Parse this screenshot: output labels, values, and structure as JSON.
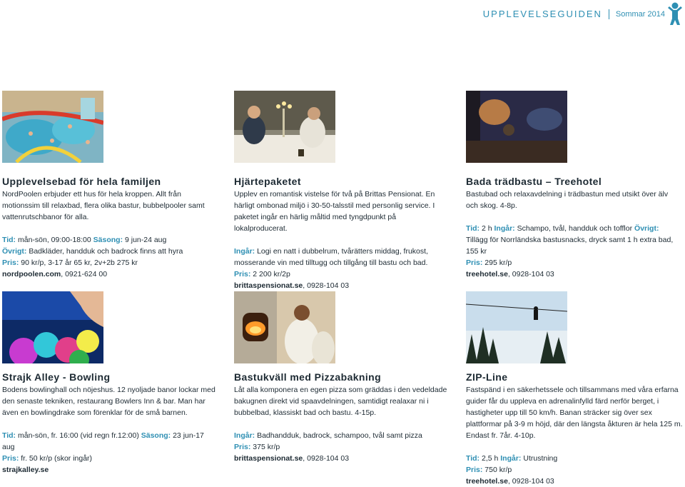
{
  "header": {
    "title": "UPPLEVELSEGUIDEN",
    "season": "Sommar 2014",
    "logo_icon": "person-jumping-icon"
  },
  "colors": {
    "accent": "#2e8fb3",
    "text": "#1d2a33"
  },
  "cards": [
    {
      "title": "Upplevelsebad för hela familjen",
      "intro": "NordPoolen erbjuder ett hus för hela kroppen. Allt från motionssim till relaxbad, flera olika bastur, bubbelpooler samt vattenrutschbanor för alla.",
      "tid_label": "Tid:",
      "tid": "mån-sön, 09:00-18:00",
      "sasong_label": "Säsong:",
      "sasong": "9 jun-24 aug",
      "ovrigt_label": "Övrigt:",
      "ovrigt": "Badkläder, handduk och badrock finns att hyra",
      "pris_label": "Pris:",
      "pris": "90 kr/p, 3-17 år 65 kr, 2v+2b 275 kr",
      "web": "nordpoolen.com",
      "phone": ", 0921-624 00"
    },
    {
      "title": "Hjärtepaketet",
      "intro": "Upplev en romantisk vistelse för två på Brittas Pensionat. En härligt ombonad miljö i 30-50-talsstil med personlig service. I paketet ingår en härlig måltid med tyngdpunkt på lokalproducerat.",
      "ingar_label": "Ingår:",
      "ingar": "Logi en natt i dubbelrum, tvårätters middag, frukost, mosserande vin med tilltugg och tillgång till bastu och bad.",
      "pris_label": "Pris:",
      "pris": "2 200 kr/2p",
      "web": "brittaspensionat.se",
      "phone": ", 0928-104 03"
    },
    {
      "title": "Bada trädbastu – Treehotel",
      "intro": "Bastubad och relaxavdelning i trädbastun med utsikt över älv och skog. 4-8p.",
      "tid_label": "Tid:",
      "tid": "2 h",
      "ingar_label": "Ingår:",
      "ingar": "Schampo, tvål, handduk och tofflor",
      "ovrigt_label": "Övrigt:",
      "ovrigt": "Tillägg för Norrländska bastusnacks, dryck samt 1 h extra bad, 155 kr",
      "pris_label": "Pris:",
      "pris": "295 kr/p",
      "web": "treehotel.se",
      "phone": ", 0928-104 03"
    },
    {
      "title": "Strajk Alley - Bowling",
      "intro": "Bodens bowlinghall och nöjeshus. 12 nyoljade banor lockar med den senaste tekniken, restaurang Bowlers Inn & bar. Man har även en bowlingdrake som förenklar för de små barnen.",
      "tid_label": "Tid:",
      "tid": "mån-sön, fr. 16:00 (vid regn fr.12:00)",
      "sasong_label": "Säsong:",
      "sasong": "23 jun-17 aug",
      "pris_label": "Pris:",
      "pris": "fr. 50 kr/p (skor ingår)",
      "web": "strajkalley.se"
    },
    {
      "title": "Bastukväll med Pizzabakning",
      "intro": "Låt alla komponera en egen pizza som gräddas i den vedeldade bakugnen direkt vid spaavdelningen, samtidigt realaxar ni i bubbelbad, klassiskt bad och bastu. 4-15p.",
      "ingar_label": "Ingår:",
      "ingar": "Badhandduk, badrock, schampoo, tvål samt pizza",
      "pris_label": "Pris:",
      "pris": "375 kr/p",
      "web": "brittaspensionat.se",
      "phone": ", 0928-104 03"
    },
    {
      "title": "ZIP-Line",
      "intro": "Fastspänd i en säkerhetssele och tillsammans med våra erfarna guider får du uppleva en adrenalinfylld färd nerför berget, i hastigheter upp till 50 km/h. Banan sträcker sig över sex plattformar på 3-9 m höjd, där den längsta åkturen är hela 125 m. Endast fr. 7år. 4-10p.",
      "tid_label": "Tid:",
      "tid": "2,5 h",
      "ingar_label": "Ingår:",
      "ingar": "Utrustning",
      "pris_label": "Pris:",
      "pris": "750 kr/p",
      "web": "treehotel.se",
      "phone": ", 0928-104 03"
    }
  ]
}
